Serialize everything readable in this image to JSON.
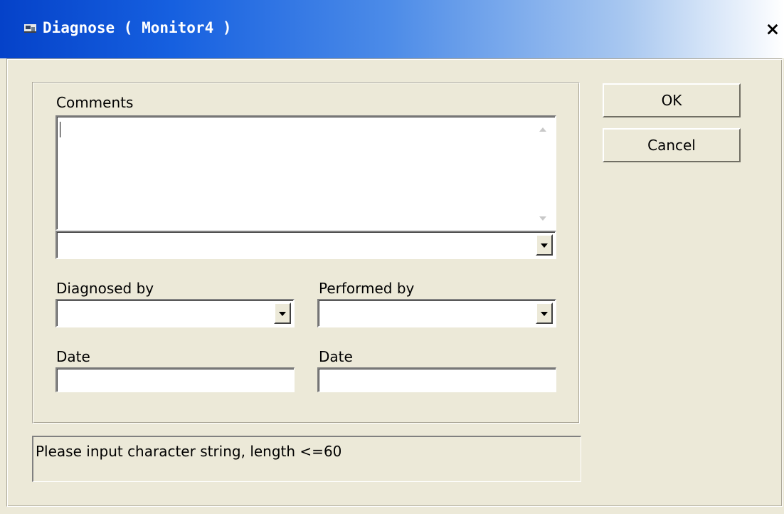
{
  "window": {
    "title": "Diagnose ( Monitor4 )",
    "close_label": "×",
    "icon": "app-window-icon"
  },
  "form": {
    "comments_label": "Comments",
    "comments_value": "",
    "comments_combo_value": "",
    "diagnosed_by_label": "Diagnosed by",
    "diagnosed_by_value": "",
    "performed_by_label": "Performed by",
    "performed_by_value": "",
    "date_label_left": "Date",
    "date_value_left": "",
    "date_label_right": "Date",
    "date_value_right": ""
  },
  "buttons": {
    "ok_label": "OK",
    "cancel_label": "Cancel"
  },
  "status": {
    "message": "Please input character string, length <=60"
  },
  "colors": {
    "dialog_background": "#ece9d8",
    "titlebar_start": "#0542c9",
    "titlebar_end": "#ffffff",
    "title_text": "#ffffff"
  }
}
